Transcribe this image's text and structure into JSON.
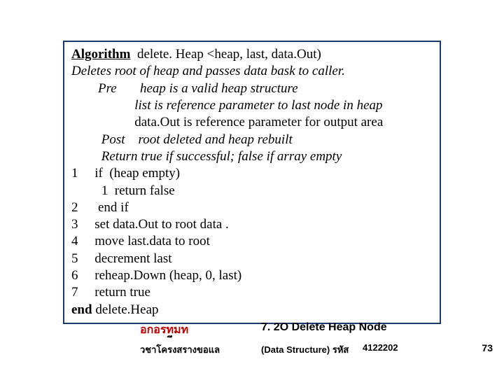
{
  "algo": {
    "title_kw": "Algorithm",
    "title_rest": "  delete. Heap <heap, last, data.Out)",
    "desc": "Deletes root of heap and passes data bask to caller.",
    "pre_kw": "Pre",
    "pre1": "       heap is a valid heap structure",
    "pre2": "                   list is reference parameter to last node in heap",
    "pre3": "                   data.Out is reference parameter for output area",
    "post_kw": "Post",
    "post_rest": "    root deleted and heap rebuilt",
    "ret": "         Return true if successful; false if array empty",
    "l1_no": "1",
    "l1": "     if  (heap empty)",
    "l1a": "         1  return false",
    "l2_no": "2",
    "l2": "      end if",
    "l3_no": "3",
    "l3": "     set data.Out to root data .",
    "l4_no": "4",
    "l4": "     move last.data to root",
    "l5_no": "5",
    "l5": "     decrement last",
    "l6_no": "6",
    "l6": "     reheap.Down (heap, 0, last)",
    "l7_no": "7",
    "l7": "     return true",
    "end_kw": "end",
    "end_rest": " delete.Heap"
  },
  "caption_label": "อกอรทมท",
  "caption_title": "7. 2O Delete Heap Node",
  "footer_b": "ึ",
  "footer_left": "วชาโครงสรางขอแล",
  "footer_mid": "(Data Structure) รหัส",
  "footer_code": "4122202",
  "page_no": "73"
}
